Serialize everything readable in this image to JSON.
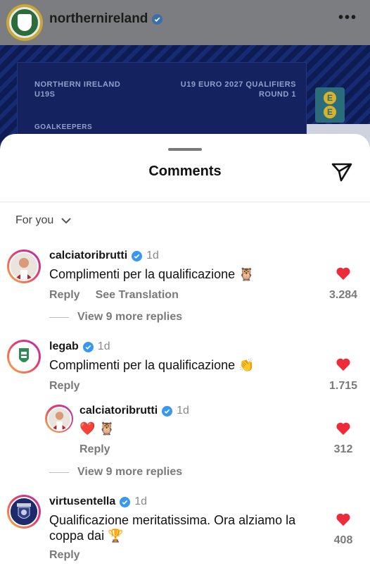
{
  "post": {
    "username": "northernireland",
    "card_left_line1": "NORTHERN IRELAND",
    "card_left_line2": "U19S",
    "card_right_line1": "U19 EURO 2027 QUALIFIERS",
    "card_right_line2": "ROUND 1",
    "card_section": "GOALKEEPERS",
    "sponsor_letters": [
      "E",
      "E"
    ]
  },
  "sheet": {
    "title": "Comments",
    "filter_label": "For you"
  },
  "comments": [
    {
      "username": "calciatoribrutti",
      "time": "1d",
      "text": "Complimenti per la qualificazione",
      "emoji": "🦉",
      "reply_label": "Reply",
      "translate_label": "See Translation",
      "likes": "3.284",
      "view_more": "View 9 more replies"
    },
    {
      "username": "legab",
      "time": "1d",
      "text": "Complimenti per la qualificazione",
      "emoji": "👏",
      "reply_label": "Reply",
      "likes": "1.715",
      "reply": {
        "username": "calciatoribrutti",
        "time": "1d",
        "emoji_1": "❤️",
        "emoji_2": "🦉",
        "reply_label": "Reply",
        "likes": "312"
      },
      "view_more": "View 9 more replies"
    },
    {
      "username": "virtusentella",
      "time": "1d",
      "text_line1": "Qualificazione meritatissima. Ora alziamo la",
      "text_line2": "coppa dai",
      "emoji": "🏆",
      "reply_label": "Reply",
      "likes": "408"
    }
  ],
  "colors": {
    "like_red": "#ed2b3a",
    "verified_blue": "#3897f0",
    "muted_text": "#7a7a7a"
  }
}
